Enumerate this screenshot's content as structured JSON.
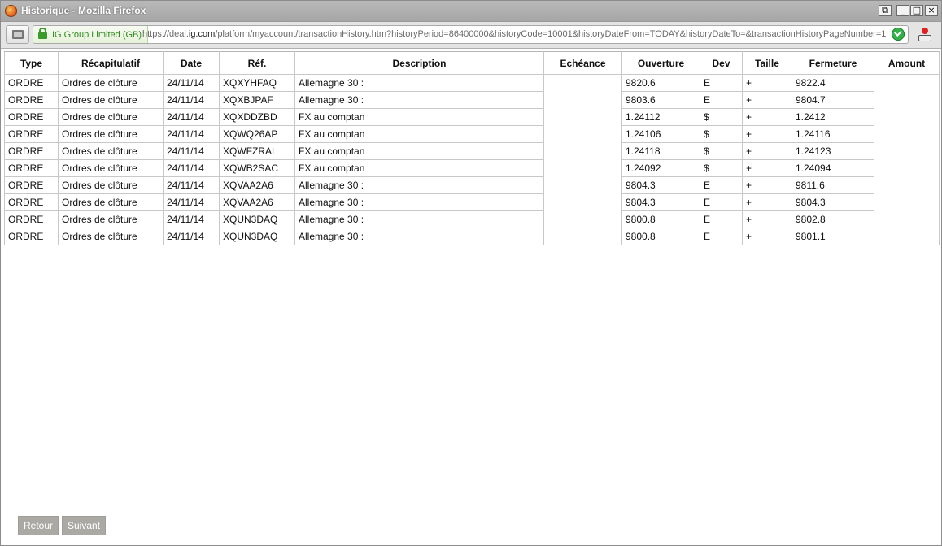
{
  "window": {
    "title": "Historique - Mozilla Firefox",
    "min": "_",
    "max": "□",
    "close": "×",
    "restore": "⧉"
  },
  "urlbar": {
    "identity": "IG Group Limited (GB)",
    "url_prefix": "https://deal.",
    "url_domain": "ig.com",
    "url_suffix": "/platform/myaccount/transactionHistory.htm?historyPeriod=86400000&historyCode=10001&historyDateFrom=TODAY&historyDateTo=&transactionHistoryPageNumber=1"
  },
  "table": {
    "headers": [
      "Type",
      "Récapitulatif",
      "Date",
      "Réf.",
      "Description",
      "Echéance",
      "Ouverture",
      "Dev",
      "Taille",
      "Fermeture",
      "Amount"
    ],
    "rows": [
      [
        "ORDRE",
        "Ordres de clôture",
        "24/11/14",
        "XQXYHFAQ",
        "Allemagne 30 :",
        "",
        "9820.6",
        "E",
        "+",
        "9822.4",
        ""
      ],
      [
        "ORDRE",
        "Ordres de clôture",
        "24/11/14",
        "XQXBJPAF",
        "Allemagne 30 :",
        "",
        "9803.6",
        "E",
        "+",
        "9804.7",
        ""
      ],
      [
        "ORDRE",
        "Ordres de clôture",
        "24/11/14",
        "XQXDDZBD",
        "FX au comptan",
        "",
        "1.24112",
        "$",
        "+",
        "1.2412",
        ""
      ],
      [
        "ORDRE",
        "Ordres de clôture",
        "24/11/14",
        "XQWQ26AP",
        "FX au comptan",
        "",
        "1.24106",
        "$",
        "+",
        "1.24116",
        ""
      ],
      [
        "ORDRE",
        "Ordres de clôture",
        "24/11/14",
        "XQWFZRAL",
        "FX au comptan",
        "",
        "1.24118",
        "$",
        "+",
        "1.24123",
        ""
      ],
      [
        "ORDRE",
        "Ordres de clôture",
        "24/11/14",
        "XQWB2SAC",
        "FX au comptan",
        "",
        "1.24092",
        "$",
        "+",
        "1.24094",
        ""
      ],
      [
        "ORDRE",
        "Ordres de clôture",
        "24/11/14",
        "XQVAA2A6",
        "Allemagne 30 :",
        "",
        "9804.3",
        "E",
        "+",
        "9811.6",
        ""
      ],
      [
        "ORDRE",
        "Ordres de clôture",
        "24/11/14",
        "XQVAA2A6",
        "Allemagne 30 :",
        "",
        "9804.3",
        "E",
        "+",
        "9804.3",
        ""
      ],
      [
        "ORDRE",
        "Ordres de clôture",
        "24/11/14",
        "XQUN3DAQ",
        "Allemagne 30 :",
        "",
        "9800.8",
        "E",
        "+",
        "9802.8",
        ""
      ],
      [
        "ORDRE",
        "Ordres de clôture",
        "24/11/14",
        "XQUN3DAQ",
        "Allemagne 30 :",
        "",
        "9800.8",
        "E",
        "+",
        "9801.1",
        ""
      ]
    ]
  },
  "buttons": {
    "back": "Retour",
    "next": "Suivant"
  }
}
